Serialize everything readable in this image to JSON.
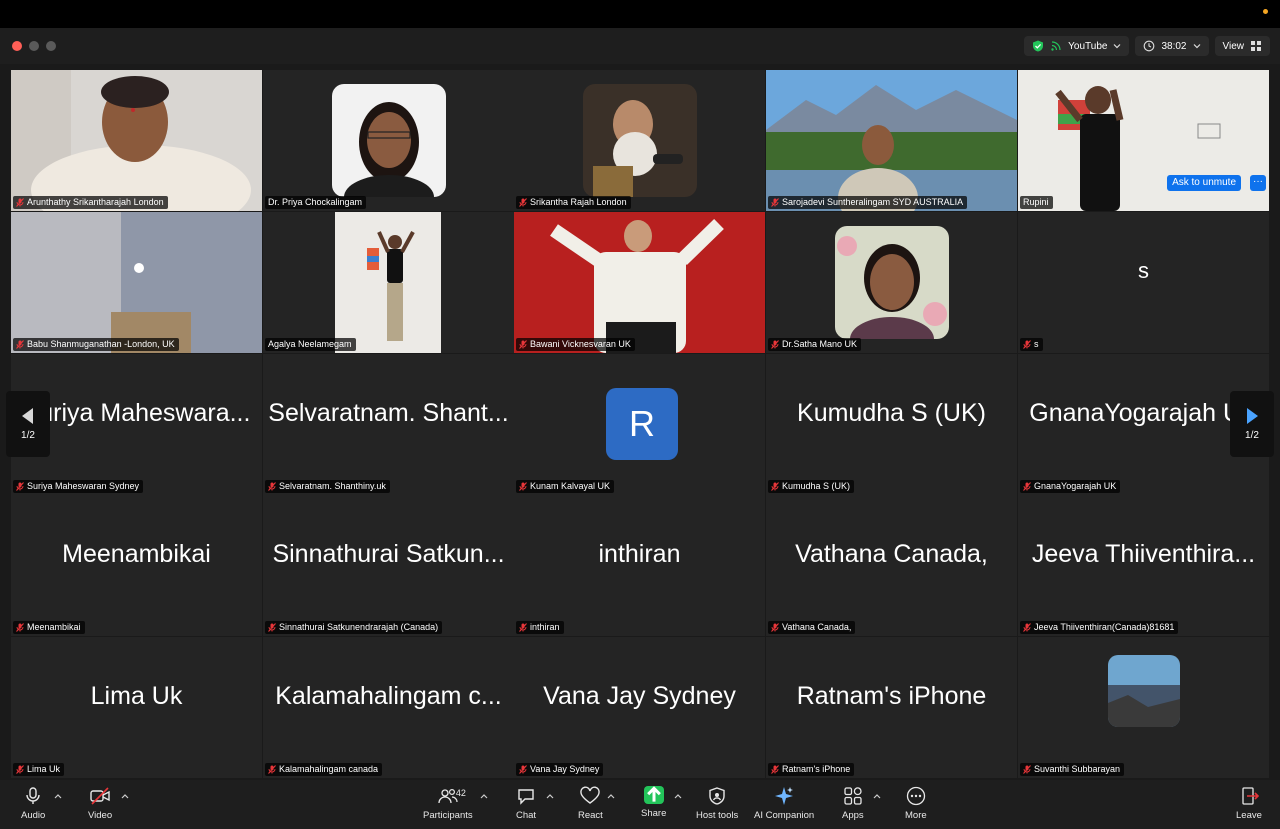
{
  "titlebar": {
    "stream_label": "YouTube",
    "timer": "38:02",
    "view_label": "View"
  },
  "tiles": [
    {
      "name": "Arunthathy Srikantharajah London",
      "muted": true
    },
    {
      "name": "Dr. Priya Chockalingam",
      "muted": false
    },
    {
      "name": "Srikantha Rajah London",
      "muted": true
    },
    {
      "name": "Sarojadevi Suntheralingam SYD AUSTRALIA",
      "muted": true
    },
    {
      "name": "Rupini",
      "muted": false
    },
    {
      "name": "Babu Shanmuganathan -London, UK",
      "muted": true
    },
    {
      "name": "Agalya Neelamegam",
      "muted": false
    },
    {
      "name": "Bawani Vicknesvaran UK",
      "muted": true
    },
    {
      "name": "Dr.Satha Mano UK",
      "muted": true
    },
    {
      "name": "s",
      "big": "s",
      "muted": true
    },
    {
      "name": "Suriya Maheswaran Sydney",
      "big": "Suriya Maheswara...",
      "muted": true
    },
    {
      "name": "Selvaratnam. Shanthiny.uk",
      "big": "Selvaratnam. Shant...",
      "muted": true
    },
    {
      "name": "Kunam Kalvayal UK",
      "avatar": "R",
      "muted": true
    },
    {
      "name": "Kumudha S (UK)",
      "big": "Kumudha S (UK)",
      "muted": true
    },
    {
      "name": "GnanaYogarajah UK",
      "big": "GnanaYogarajah UK",
      "muted": true
    },
    {
      "name": "Meenambikai",
      "big": "Meenambikai",
      "muted": true
    },
    {
      "name": "Sinnathurai Satkunendrarajah (Canada)",
      "big": "Sinnathurai Satkun...",
      "muted": true
    },
    {
      "name": "inthiran",
      "big": "inthiran",
      "muted": true
    },
    {
      "name": "Vathana Canada,",
      "big": "Vathana Canada,",
      "muted": true
    },
    {
      "name": "Jeeva Thiiventhiran(Canada)81681",
      "big": "Jeeva Thiiventhira...",
      "muted": true
    },
    {
      "name": "Lima  Uk",
      "big": "Lima  Uk",
      "muted": true
    },
    {
      "name": "Kalamahalingam canada",
      "big": "Kalamahalingam c...",
      "muted": true
    },
    {
      "name": "Vana Jay Sydney",
      "big": "Vana Jay Sydney",
      "muted": true
    },
    {
      "name": "Ratnam's iPhone",
      "big": "Ratnam's iPhone",
      "muted": true
    },
    {
      "name": "Suvanthi Subbarayan",
      "muted": true
    }
  ],
  "ask_to_unmute": "Ask to unmute",
  "more_dots": "···",
  "pager": {
    "left": "1/2",
    "right": "1/2"
  },
  "toolbar": {
    "audio": "Audio",
    "video": "Video",
    "participants": "Participants",
    "participant_count": "42",
    "chat": "Chat",
    "react": "React",
    "share": "Share",
    "host_tools": "Host tools",
    "ai_companion": "AI Companion",
    "apps": "Apps",
    "more": "More",
    "leave": "Leave"
  },
  "colors": {
    "accent_blue": "#0e72ed",
    "speaker_green": "#62d26f",
    "mute_red": "#e8363a",
    "share_green": "#23c45a"
  }
}
